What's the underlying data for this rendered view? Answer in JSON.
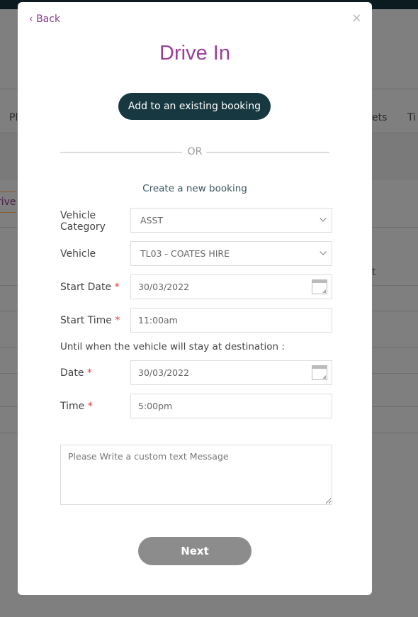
{
  "background": {
    "tab_left": "Pl",
    "tab_right1": "ets",
    "tab_right2": "Ti",
    "side_tab": "rive",
    "col_fragment": "t"
  },
  "modal": {
    "back_label": "Back",
    "close_label": "×",
    "title": "Drive In",
    "existing_button": "Add to an existing booking",
    "or_label": "OR",
    "create_label": "Create a new booking",
    "required_mark": "*",
    "fields": {
      "vehicle_category": {
        "label": "Vehicle Category",
        "value": "ASST"
      },
      "vehicle": {
        "label": "Vehicle",
        "value": "TL03 - COATES HIRE"
      },
      "start_date": {
        "label": "Start Date",
        "value": "30/03/2022"
      },
      "start_time": {
        "label": "Start Time",
        "value": "11:00am"
      },
      "until_label": "Until when the vehicle will stay at destination :",
      "end_date": {
        "label": "Date",
        "value": "30/03/2022"
      },
      "end_time": {
        "label": "Time",
        "value": "5:00pm"
      }
    },
    "message_placeholder": "Please Write a custom text Message",
    "next_button": "Next"
  },
  "colors": {
    "title": "#9b3f9b",
    "primary_button": "#173840",
    "disabled_button": "#8c8c8c",
    "required": "#e33333"
  }
}
